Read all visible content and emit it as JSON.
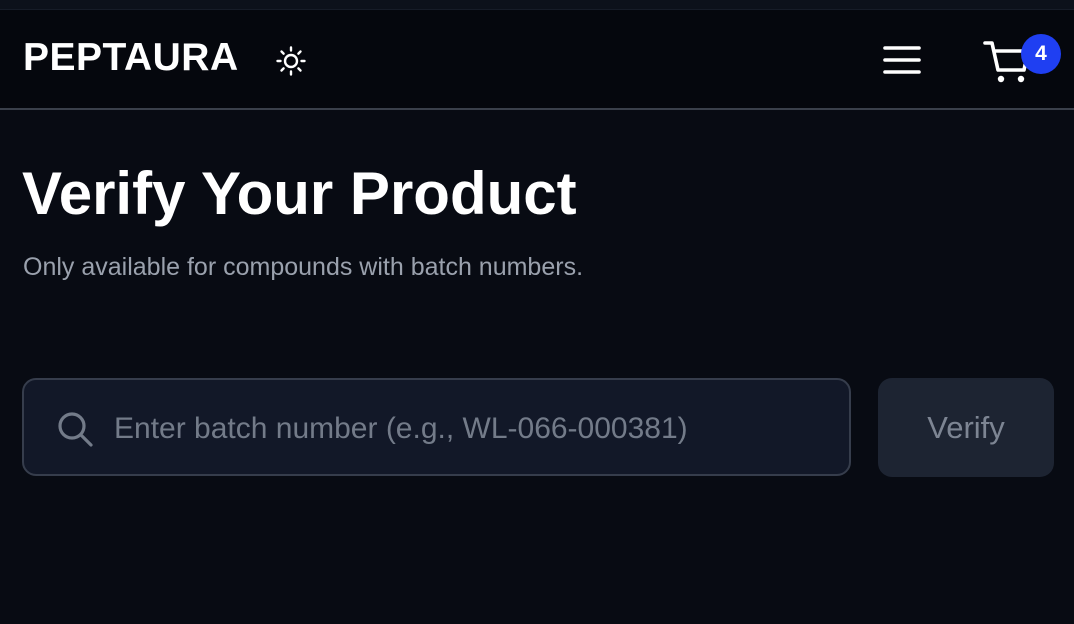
{
  "header": {
    "logo": "PEPTAURA",
    "theme_icon": "sun-icon",
    "menu_icon": "hamburger-menu-icon",
    "cart_icon": "shopping-cart-icon",
    "cart_count": "4",
    "badge_color": "#1f3ff2"
  },
  "main": {
    "title": "Verify Your Product",
    "subtitle": "Only available for compounds with batch numbers."
  },
  "search": {
    "icon": "search-icon",
    "placeholder": "Enter batch number (e.g., WL-066-000381)",
    "value": "",
    "button_label": "Verify"
  }
}
